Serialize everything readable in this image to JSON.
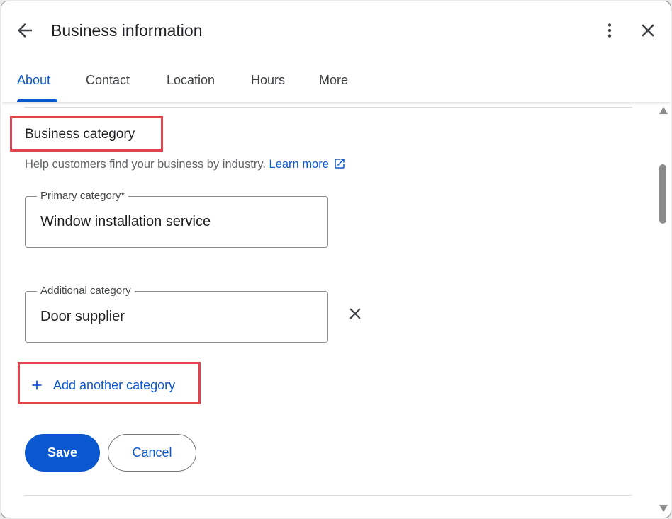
{
  "header": {
    "title": "Business information",
    "back_icon": "arrow-left-icon",
    "more_icon": "more-vertical-icon",
    "close_icon": "close-icon"
  },
  "tabs": [
    {
      "label": "About",
      "active": true
    },
    {
      "label": "Contact",
      "active": false
    },
    {
      "label": "Location",
      "active": false
    },
    {
      "label": "Hours",
      "active": false
    },
    {
      "label": "More",
      "active": false
    }
  ],
  "section": {
    "title": "Business category",
    "helper_text": "Help customers find your business by industry.",
    "learn_more": "Learn more"
  },
  "primary_field": {
    "label": "Primary category*",
    "value": "Window installation service"
  },
  "additional_field": {
    "label": "Additional category",
    "value": "Door supplier"
  },
  "add_category_label": "Add another category",
  "actions": {
    "save": "Save",
    "cancel": "Cancel"
  },
  "colors": {
    "accent": "#0b57d0",
    "highlight": "#e4434e",
    "text": "#202124",
    "muted": "#5f6368"
  }
}
